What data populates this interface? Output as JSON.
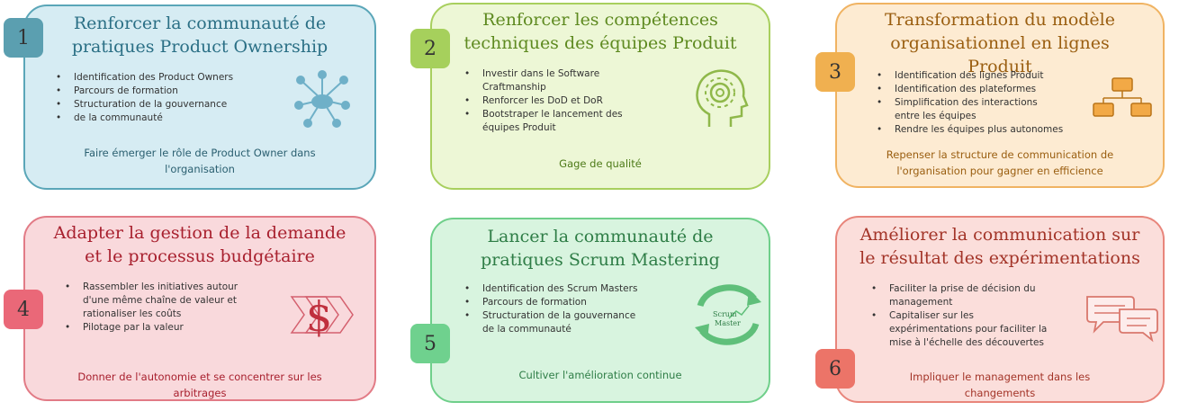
{
  "cards": [
    {
      "number": "1",
      "title_line1": "Renforcer la communauté de",
      "title_line2": "pratiques Product Ownership",
      "bullets": [
        "Identification des Product Owners",
        "Parcours de formation",
        "Structuration de la gouvernance",
        "de la communauté"
      ],
      "footer_line1": "Faire émerger le rôle de Product Owner dans",
      "footer_line2": "l'organisation",
      "icon": "network-cloud-icon",
      "color_bg": "#d6ecf3",
      "color_border": "#5aa6b8",
      "color_title": "#2a6f85",
      "color_badge": "#5b9fb0"
    },
    {
      "number": "2",
      "title_line1": "Renforcer les compétences",
      "title_line2": "techniques des équipes Produit",
      "bullets": [
        "Investir dans le Software",
        "Craftmanship",
        "Renforcer les DoD et DoR",
        "Bootstraper le lancement des",
        "équipes Produit"
      ],
      "footer_line1": "Gage de qualité",
      "footer_line2": "",
      "icon": "head-gear-icon",
      "color_bg": "#edf7d6",
      "color_border": "#a8cf5e",
      "color_title": "#5e8a20",
      "color_badge": "#a6d05c"
    },
    {
      "number": "3",
      "title_line1": "Transformation du modèle",
      "title_line2": "organisationnel en lignes",
      "title_line3": "Produit",
      "bullets": [
        "Identification des lignes Produit",
        "Identification des plateformes",
        "Simplification des interactions",
        "entre les équipes",
        "Rendre les équipes plus autonomes"
      ],
      "footer_line1": "Repenser la structure de communication de",
      "footer_line2": "l'organisation pour gagner en efficience",
      "icon": "org-chart-icon",
      "color_bg": "#fdebd2",
      "color_border": "#f0b362",
      "color_title": "#9a5e10",
      "color_badge": "#f0b050"
    },
    {
      "number": "4",
      "title_line1": "Adapter la gestion de la demande",
      "title_line2": "et le processus budgétaire",
      "bullets": [
        "Rassembler les initiatives autour",
        "d'une même chaîne de valeur et",
        "rationaliser les coûts",
        "Pilotage par la valeur"
      ],
      "footer_line1": "Donner de l'autonomie et se concentrer sur les",
      "footer_line2": "arbitrages",
      "icon": "dollar-icon",
      "color_bg": "#f9d9dc",
      "color_border": "#e27b86",
      "color_title": "#a8202e",
      "color_badge": "#ea6878"
    },
    {
      "number": "5",
      "title_line1": "Lancer la communauté de",
      "title_line2": "pratiques Scrum Mastering",
      "bullets": [
        "Identification des Scrum Masters",
        "Parcours de formation",
        "Structuration de la gouvernance",
        "de la communauté"
      ],
      "footer_line1": "Cultiver l'amélioration continue",
      "footer_line2": "",
      "icon": "scrum-cycle-icon",
      "icon_text_1": "Scrum",
      "icon_text_2": "Master",
      "color_bg": "#d8f4df",
      "color_border": "#6fcf8a",
      "color_title": "#2e7d46",
      "color_badge": "#6fd18e"
    },
    {
      "number": "6",
      "title_line1": "Améliorer la communication sur",
      "title_line2": "le résultat des expérimentations",
      "bullets": [
        "Faciliter la prise de décision du",
        "management",
        "Capitaliser sur les",
        "expérimentations pour faciliter la",
        "mise à l'échelle des découvertes"
      ],
      "footer_line1": "Impliquer le management dans les",
      "footer_line2": "changements",
      "icon": "speech-bubbles-icon",
      "color_bg": "#fbdedb",
      "color_border": "#e8857b",
      "color_title": "#a33428",
      "color_badge": "#ec7468"
    }
  ]
}
